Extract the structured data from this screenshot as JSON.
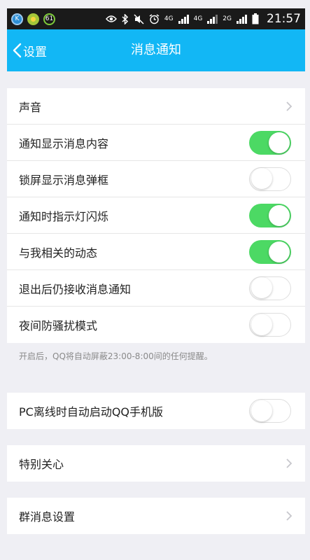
{
  "status_bar": {
    "time": "21:57",
    "battery_badge": "61",
    "left_icons": [
      "k-app-icon",
      "sun-app-icon",
      "battery-ring-icon"
    ],
    "right_icons": [
      "eye-icon",
      "bluetooth-icon",
      "muted-icon",
      "alarm-icon",
      "network-4g-icon",
      "network-4g-icon",
      "network-2g-icon",
      "battery-icon"
    ],
    "net1": "4G",
    "net2": "4G",
    "net3": "2G"
  },
  "nav": {
    "back_label": "设置",
    "title": "消息通知"
  },
  "settings": {
    "sound": {
      "label": "声音"
    },
    "toggles": [
      {
        "label": "通知显示消息内容",
        "on": true
      },
      {
        "label": "锁屏显示消息弹框",
        "on": false
      },
      {
        "label": "通知时指示灯闪烁",
        "on": true
      },
      {
        "label": "与我相关的动态",
        "on": true
      },
      {
        "label": "退出后仍接收消息通知",
        "on": false
      },
      {
        "label": "夜间防骚扰模式",
        "on": false
      }
    ],
    "night_hint": "开启后，QQ将自动屏蔽23:00-8:00间的任何提醒。",
    "pc_offline": {
      "label": "PC离线时自动启动QQ手机版",
      "on": false
    },
    "special_care": {
      "label": "特别关心"
    },
    "group_msg": {
      "label": "群消息设置"
    }
  },
  "colors": {
    "nav_bg": "#12b7f5",
    "toggle_on": "#4cd964",
    "page_bg": "#efeff4"
  }
}
